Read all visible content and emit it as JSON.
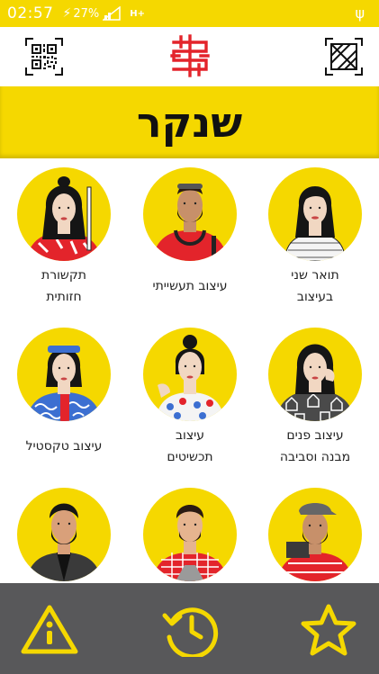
{
  "status": {
    "time": "02:57",
    "battery": "27%",
    "network": "H+"
  },
  "header": {
    "title": "שנקר"
  },
  "colors": {
    "brand_yellow": "#f5d800",
    "logo_red": "#e3242b",
    "bottom_bar": "#58585a"
  },
  "icons": {
    "left": "qr-code-icon",
    "right": "map-icon",
    "bottom": [
      "info-icon",
      "history-icon",
      "star-icon"
    ]
  },
  "departments": [
    {
      "line1": "תואר שני",
      "line2": "בעיצוב"
    },
    {
      "line1": "עיצוב תעשייתי",
      "line2": ""
    },
    {
      "line1": "תקשורת",
      "line2": "חזותית"
    },
    {
      "line1": "עיצוב פנים",
      "line2": "מבנה וסביבה"
    },
    {
      "line1": "עיצוב",
      "line2": "תכשיטים"
    },
    {
      "line1": "עיצוב טקסטיל",
      "line2": ""
    },
    {
      "line1": "",
      "line2": ""
    },
    {
      "line1": "",
      "line2": ""
    },
    {
      "line1": "",
      "line2": ""
    }
  ]
}
